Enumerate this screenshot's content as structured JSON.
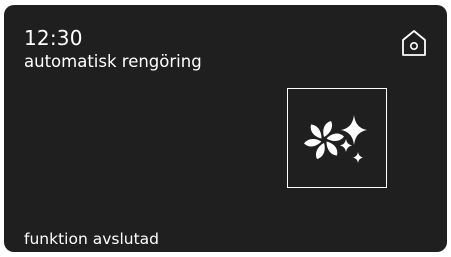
{
  "header": {
    "time": "12:30",
    "mode_title": "automatisk rengöring",
    "home_icon": "home-icon"
  },
  "program": {
    "icon": "fan-sparkle-cleaning-icon"
  },
  "footer": {
    "status": "funktion avslutad"
  },
  "colors": {
    "background": "#1f1f1f",
    "foreground": "#ffffff"
  }
}
